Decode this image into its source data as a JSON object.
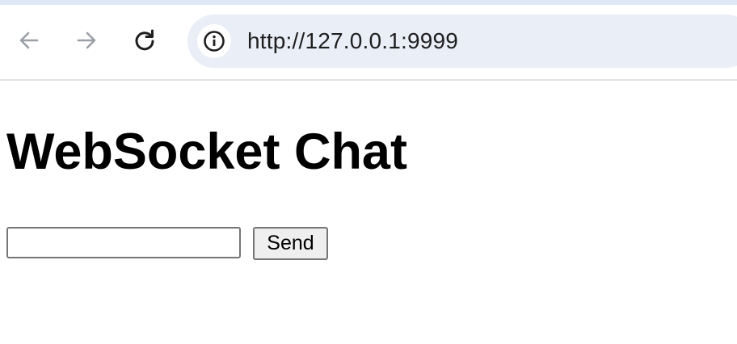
{
  "browser": {
    "url": "http://127.0.0.1:9999",
    "icons": {
      "back": "arrow-left-icon",
      "forward": "arrow-right-icon",
      "reload": "reload-icon",
      "site_info": "info-icon"
    },
    "colors": {
      "omnibox_bg": "#eaeef7",
      "top_strip": "#dfe6f6",
      "disabled_icon": "#9aa0a6",
      "active_icon": "#1f1f1f"
    }
  },
  "page": {
    "title": "WebSocket Chat",
    "message_input": {
      "value": "",
      "placeholder": ""
    },
    "send_label": "Send"
  }
}
